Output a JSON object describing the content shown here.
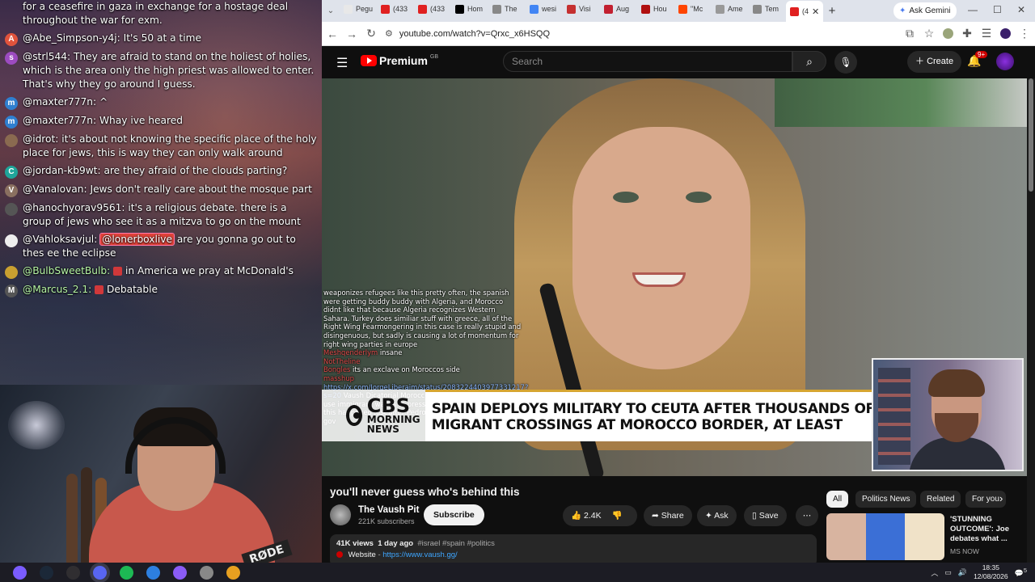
{
  "chat": {
    "messages": [
      {
        "user": "",
        "text": "for a ceasefire in gaza in exchange for a hostage deal throughout the war for exm.",
        "avatar_letter": "",
        "avatar_color": "#7a4a3a"
      },
      {
        "user": "@Abe_Simpson-y4j:",
        "text": "It's 50 at a time",
        "avatar_letter": "A",
        "avatar_color": "#e0533c"
      },
      {
        "user": "@strl544:",
        "text": "They are afraid to stand on the holiest of holies, which is the area only the high priest was allowed to enter. That's why they go around I guess.",
        "avatar_letter": "s",
        "avatar_color": "#9c4bc0"
      },
      {
        "user": "@maxter777n:",
        "text": "^",
        "avatar_letter": "m",
        "avatar_color": "#2f7fd0"
      },
      {
        "user": "@maxter777n:",
        "text": "Whay ive heared",
        "avatar_letter": "m",
        "avatar_color": "#2f7fd0"
      },
      {
        "user": "@idrot:",
        "text": "it's about not knowing the specific place of the holy place for jews, this is way they can only walk around",
        "avatar_letter": "",
        "avatar_color": "#8a6a50"
      },
      {
        "user": "@jordan-kb9wt:",
        "text": "are they afraid of the clouds parting?",
        "avatar_letter": "C",
        "avatar_color": "#1fa59a"
      },
      {
        "user": "@Vanalovan:",
        "text": "Jews don't really care about the mosque part",
        "avatar_letter": "V",
        "avatar_color": "#8a7060"
      },
      {
        "user": "@hanochyorav9561:",
        "text": "it's a religious debate. there is a group of jews who see it as a mitzva to go on the mount",
        "avatar_letter": "",
        "avatar_color": "#555"
      },
      {
        "user": "@Vahloksavjul:",
        "mention": "@lonerboxlive",
        "text": "are you gonna go out to thes ee the eclipse",
        "avatar_letter": "",
        "avatar_color": "#eee"
      },
      {
        "user": "@BulbSweetBulb:",
        "text": "in America we pray at McDonald's",
        "avatar_letter": "",
        "avatar_color": "#c9a030",
        "green": true
      },
      {
        "user": "@Marcus_2.1:",
        "text": "Debatable",
        "avatar_letter": "M",
        "avatar_color": "#555",
        "green": true
      }
    ]
  },
  "webcam": {
    "mic_brand": "RØDE"
  },
  "browser": {
    "tabs": [
      {
        "label": "Pegu",
        "color": "#e8e8e8"
      },
      {
        "label": "(433",
        "color": "#e02020"
      },
      {
        "label": "(433",
        "color": "#e02020"
      },
      {
        "label": "Hom",
        "color": "#000000"
      },
      {
        "label": "The",
        "color": "#888888"
      },
      {
        "label": "wesi",
        "color": "#4285f4"
      },
      {
        "label": "Visi",
        "color": "#c53030"
      },
      {
        "label": "Aug",
        "color": "#c22030"
      },
      {
        "label": "Hou",
        "color": "#b01010"
      },
      {
        "label": "\"Mc",
        "color": "#ff4500"
      },
      {
        "label": "Ame",
        "color": "#999999"
      },
      {
        "label": "Tem",
        "color": "#888888"
      },
      {
        "label": "(4",
        "color": "#e02020",
        "active": true
      }
    ],
    "new_tab": "+",
    "ask_gemini": "Ask Gemini",
    "url": "youtube.com/watch?v=Qrxc_x6HSQQ",
    "window_controls": {
      "minimize": "—",
      "maximize": "☐",
      "close": "✕"
    }
  },
  "youtube": {
    "logo": "Premium",
    "region": "GB",
    "search_placeholder": "Search",
    "create_label": "Create",
    "notifications_badge": "9+",
    "video": {
      "overlay_chat": [
        {
          "user": "",
          "text": "weaponizes refugees like this pretty often, the spanish were getting buddy buddy with Algeria, and Morocco didnt like that because Algeria recognizes Western Sahara. Turkey does similiar stuff with greece, all of the Right Wing Fearmongering in this case is really stupid and disingenuous, but sadly is causing a lot of momentum for right wing parties in europe"
        },
        {
          "user": "Meshqenderlym",
          "text": "insane"
        },
        {
          "user": "NotTheline",
          "text": ""
        },
        {
          "user": "Bongles",
          "text": "its an exclave on Moroccos side"
        },
        {
          "user": "masshup",
          "text": ""
        },
        {
          "user": "",
          "link": "https://x.com/JorgeLiberaim/status/2083224403977331217?s=20",
          "text": "Vaush Dicatorial Morocco gov has been known to use immigrant waves to pressure spain diplomatically, this happened just after Pedro Sanches visited algerian gov"
        }
      ],
      "network": "CBS",
      "network_sub": "MORNING NEWS",
      "headline_line1": "SPAIN DEPLOYS MILITARY TO CEUTA AFTER THOUSANDS OF",
      "headline_line2": "MIGRANT CROSSINGS AT MOROCCO BORDER, AT LEAST"
    },
    "title": "you'll never guess who's behind this",
    "channel": {
      "name": "The Vaush Pit",
      "subscribers": "221K subscribers",
      "subscribe_label": "Subscribe"
    },
    "actions": {
      "likes": "2.4K",
      "share": "Share",
      "ask": "Ask",
      "save": "Save",
      "more": "⋯"
    },
    "description": {
      "views": "41K views",
      "age": "1 day ago",
      "tags": "#israel #spain #politics",
      "website_label": "Website",
      "website_url": "https://www.vaush.gg/"
    },
    "chips": [
      "All",
      "Politics News",
      "Related",
      "For you"
    ],
    "recommendation": {
      "title": "'STUNNING OUTCOME': Joe debates what ...",
      "channel": "MS NOW",
      "thumb_colors": [
        "#d8b4a0",
        "#3b6fd6",
        "#f0e2c8"
      ]
    }
  },
  "taskbar": {
    "icons": [
      {
        "name": "start-icon",
        "color": "#7a5cff"
      },
      {
        "name": "steam-icon",
        "color": "#1b2838"
      },
      {
        "name": "obs-icon",
        "color": "#302e31"
      },
      {
        "name": "discord-icon",
        "color": "#5865f2"
      },
      {
        "name": "spotify-icon",
        "color": "#1db954"
      },
      {
        "name": "app-icon-blue",
        "color": "#2d7fe0"
      },
      {
        "name": "app-icon-purple",
        "color": "#8b5cf6"
      },
      {
        "name": "app-icon-gray",
        "color": "#888888"
      },
      {
        "name": "chrome-icon",
        "color": "#e8a020"
      }
    ],
    "time": "18:35",
    "date": "12/08/2026",
    "notifications": "5"
  }
}
